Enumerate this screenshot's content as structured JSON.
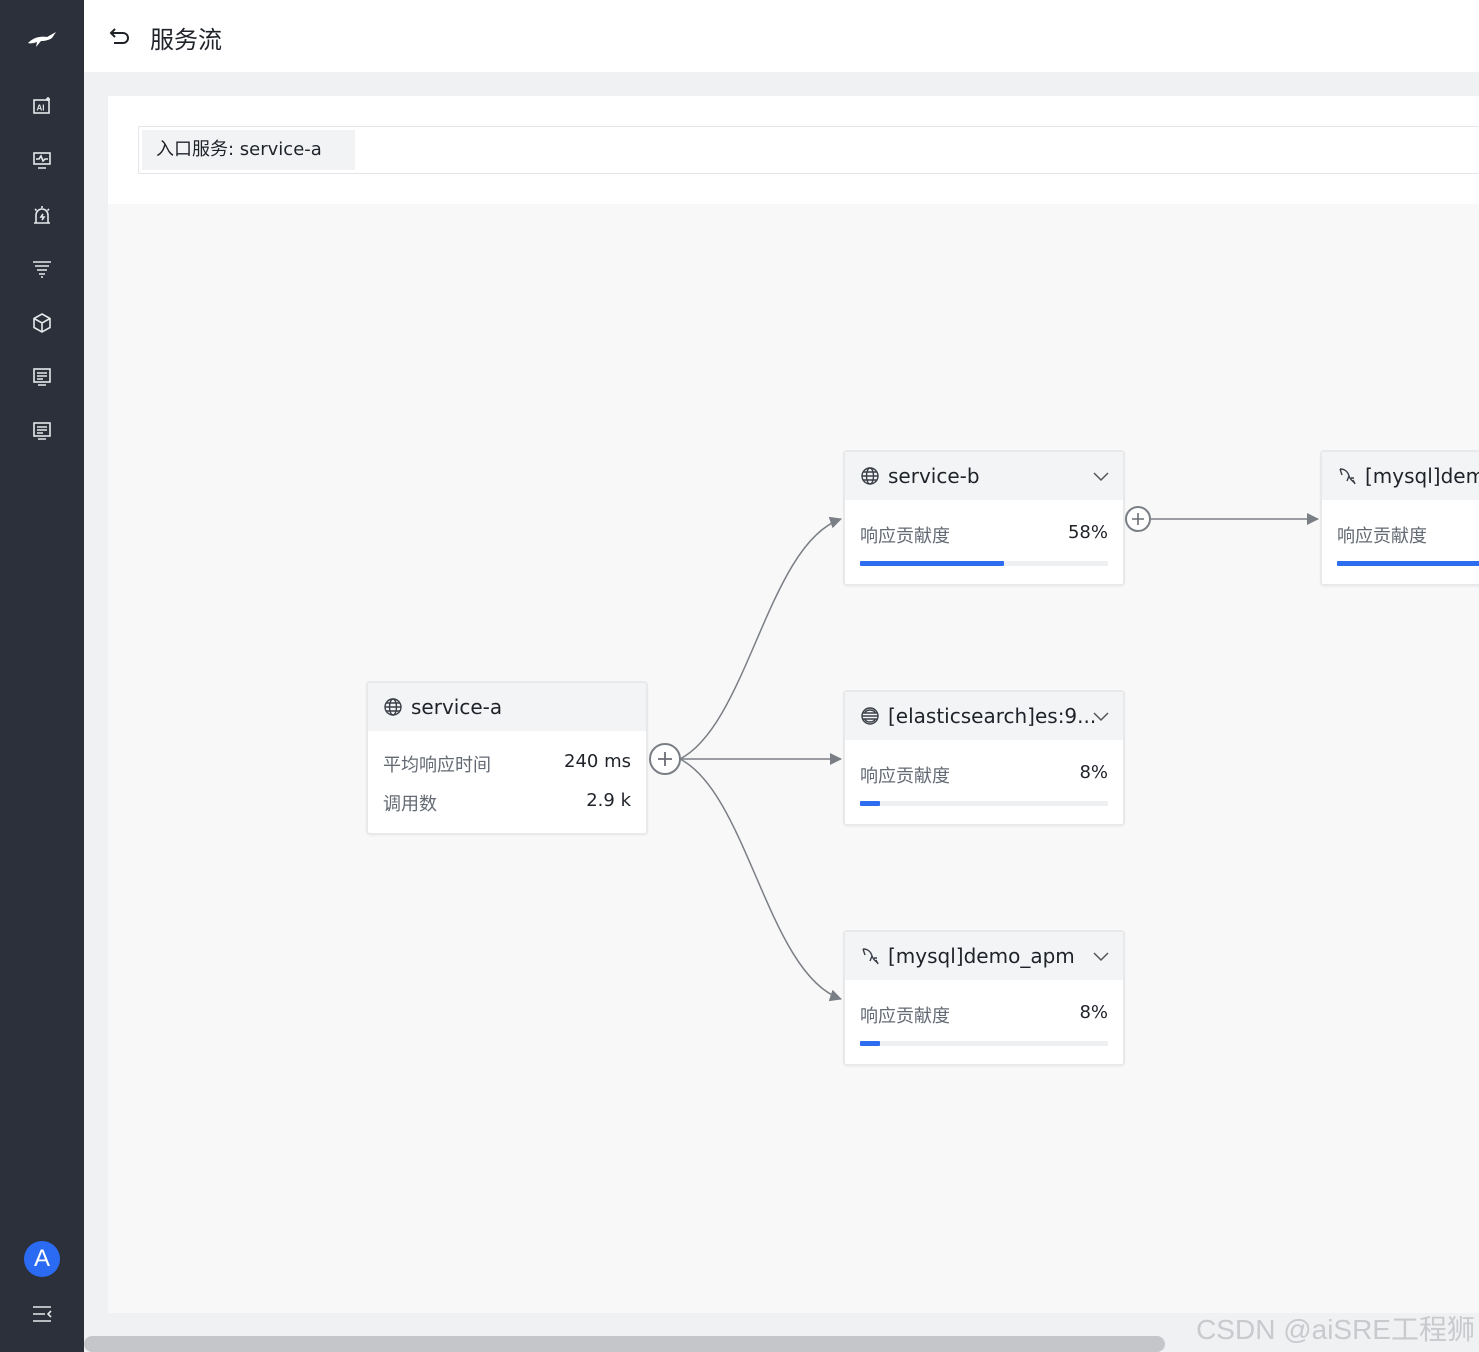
{
  "header": {
    "title": "服务流"
  },
  "toolbar": {
    "entry_service": "入口服务: service-a"
  },
  "sidebar": {
    "items": [
      {
        "icon": "ai-icon"
      },
      {
        "icon": "monitor-icon"
      },
      {
        "icon": "alarm-icon"
      },
      {
        "icon": "filter-icon"
      },
      {
        "icon": "cube-icon"
      },
      {
        "icon": "log-icon"
      },
      {
        "icon": "report-icon"
      }
    ],
    "avatar_letter": "A"
  },
  "nodes": {
    "service_a": {
      "name": "service-a",
      "icon": "globe-icon",
      "metrics": [
        {
          "label": "平均响应时间",
          "value": "240 ms"
        },
        {
          "label": "调用数",
          "value": "2.9 k"
        }
      ]
    },
    "service_b": {
      "name": "service-b",
      "icon": "globe-icon",
      "metric_label": "响应贡献度",
      "metric_value": "58%",
      "fraction": 0.58
    },
    "elasticsearch": {
      "name": "[elasticsearch]es:9...",
      "icon": "elasticsearch-icon",
      "metric_label": "响应贡献度",
      "metric_value": "8%",
      "fraction": 0.08
    },
    "mysql_apm": {
      "name": "[mysql]demo_apm",
      "icon": "mysql-icon",
      "metric_label": "响应贡献度",
      "metric_value": "8%",
      "fraction": 0.08
    },
    "mysql_right": {
      "name": "[mysql]demo",
      "icon": "mysql-icon",
      "metric_label": "响应贡献度",
      "fraction": 0.58
    }
  },
  "watermark": "CSDN @aiSRE工程狮",
  "colors": {
    "accent": "#2d6ef0",
    "sidebar": "#2b303b"
  }
}
